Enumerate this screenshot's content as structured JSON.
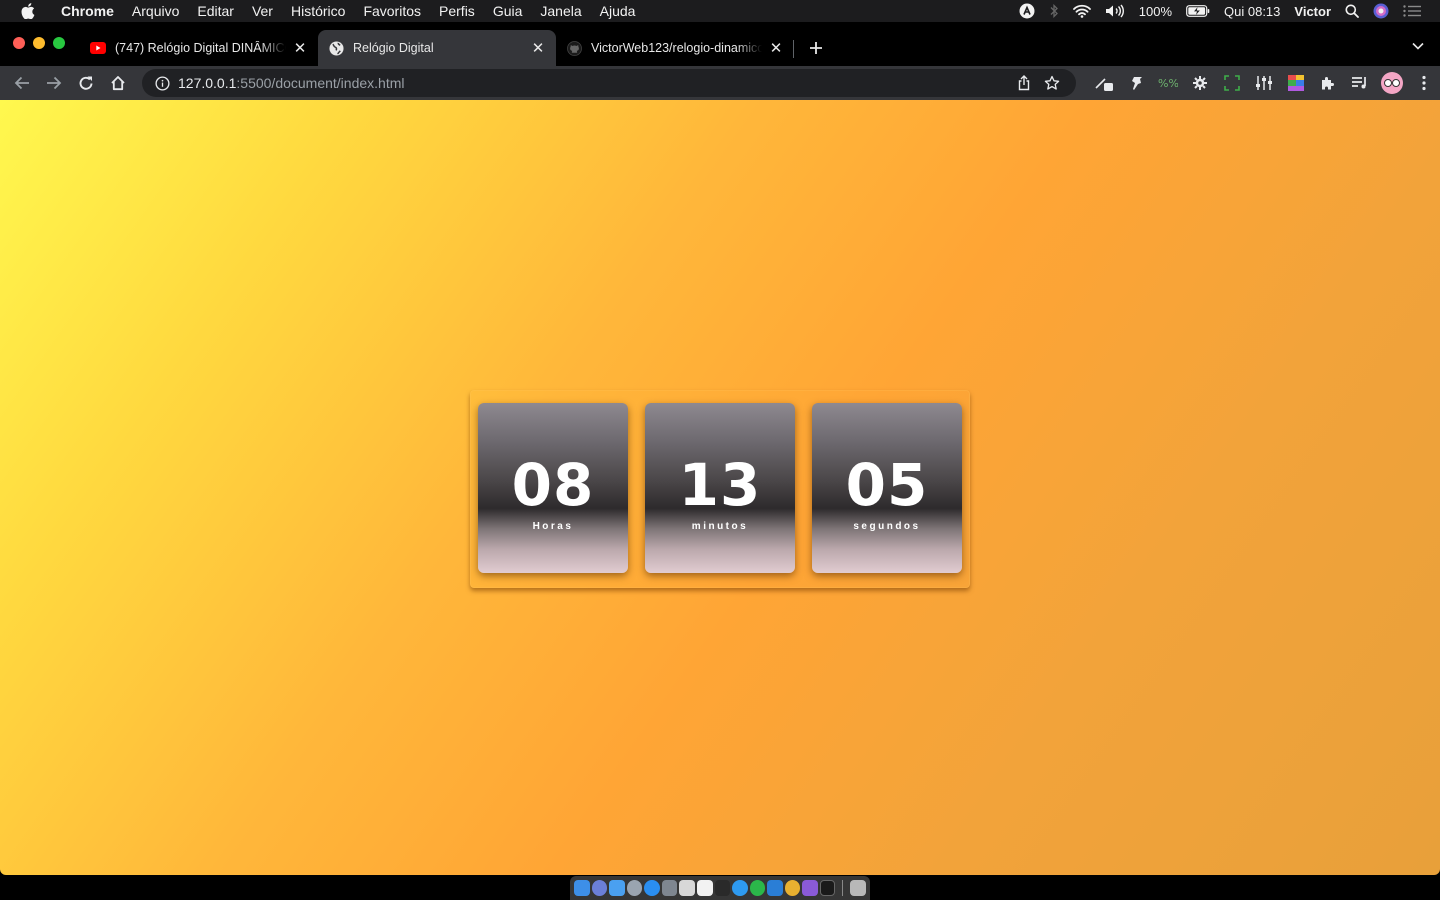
{
  "menubar": {
    "app_name": "Chrome",
    "items": [
      "Arquivo",
      "Editar",
      "Ver",
      "Histórico",
      "Favoritos",
      "Perfis",
      "Guia",
      "Janela",
      "Ajuda"
    ],
    "battery": "100%",
    "clock": "Qui 08:13",
    "user": "Victor"
  },
  "tabs": [
    {
      "title": "(747) Relógio Digital DINÂMICO",
      "favicon": "youtube-icon",
      "active": false
    },
    {
      "title": "Relógio Digital",
      "favicon": "globe-icon",
      "active": true
    },
    {
      "title": "VictorWeb123/relogio-dinamico",
      "favicon": "github-icon",
      "active": false
    }
  ],
  "toolbar": {
    "url_host": "127.0.0.1",
    "url_path": ":5500/document/index.html"
  },
  "clock": {
    "hours": {
      "value": "08",
      "label": "Horas"
    },
    "minutes": {
      "value": "13",
      "label": "minutos"
    },
    "seconds": {
      "value": "05",
      "label": "segundos"
    }
  },
  "colors": {
    "gradient_start": "#fff84e",
    "gradient_mid": "#ffa535",
    "gradient_end": "#e8a03a",
    "card_top": "#8e8990",
    "card_dark": "#2d2a2c",
    "card_bottom": "#e1ccd1"
  }
}
